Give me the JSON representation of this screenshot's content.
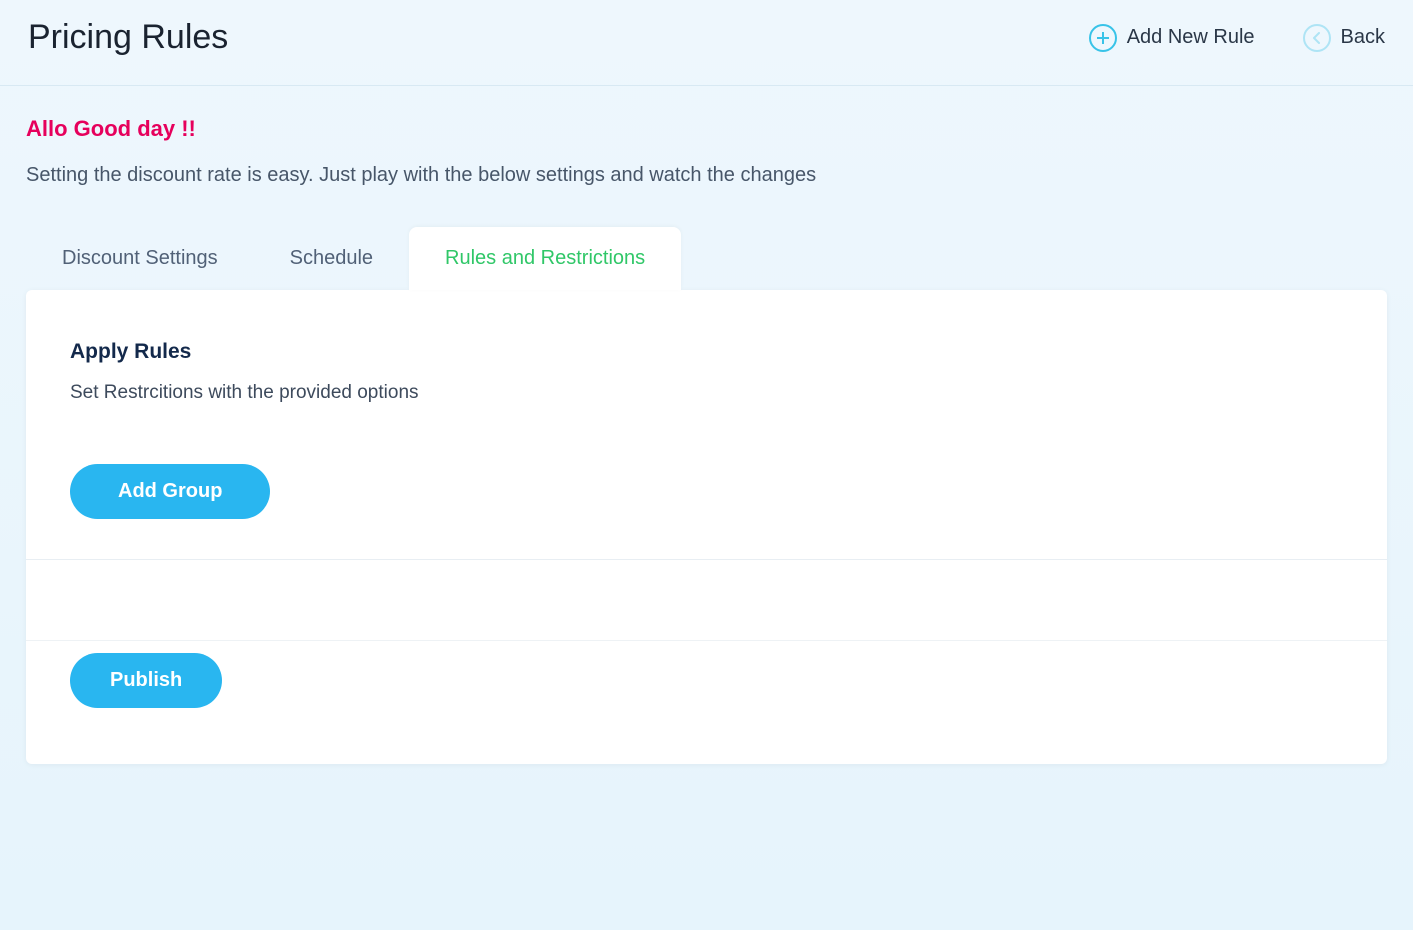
{
  "header": {
    "title": "Pricing Rules",
    "actions": {
      "add_new_rule": "Add New Rule",
      "back": "Back"
    }
  },
  "intro": {
    "greeting": "Allo Good day !!",
    "description": "Setting the discount rate is easy. Just play with the below settings and watch the changes"
  },
  "tabs": [
    {
      "label": "Discount Settings",
      "active": false
    },
    {
      "label": "Schedule",
      "active": false
    },
    {
      "label": "Rules and Restrictions",
      "active": true
    }
  ],
  "panel": {
    "section_title": "Apply Rules",
    "section_desc": "Set Restrcitions with the provided options",
    "add_group_label": "Add Group",
    "publish_label": "Publish"
  },
  "colors": {
    "accent_blue": "#29b6f0",
    "accent_green": "#30c768",
    "accent_pink": "#e6005c",
    "icon_teal": "#38c3e8"
  }
}
